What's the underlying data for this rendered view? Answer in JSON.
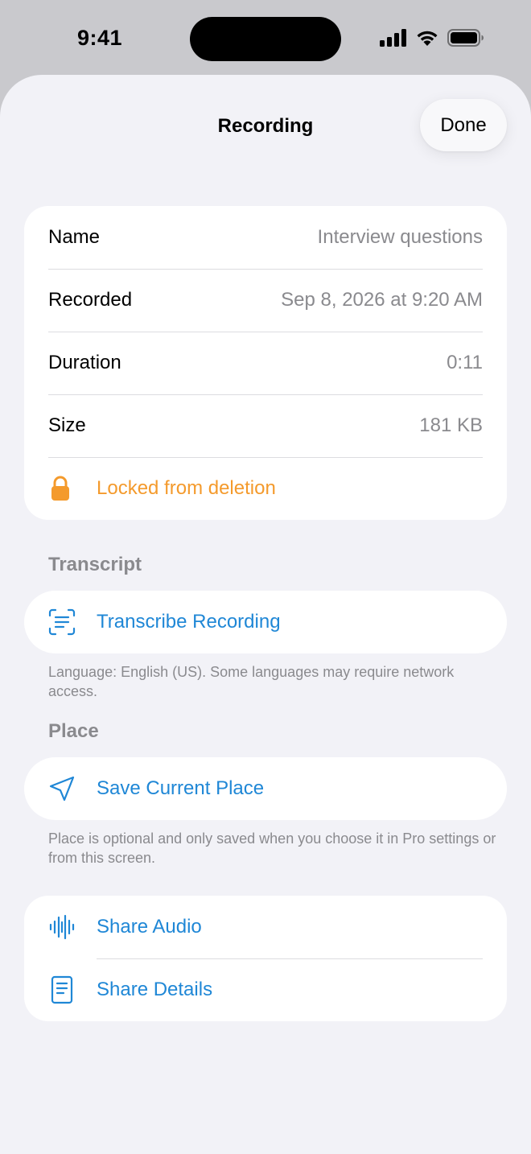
{
  "status_bar": {
    "time": "9:41"
  },
  "sheet": {
    "title": "Recording",
    "done_label": "Done"
  },
  "info": {
    "rows": [
      {
        "label": "Name",
        "value": "Interview questions"
      },
      {
        "label": "Recorded",
        "value": "Sep 8, 2026 at 9:20 AM"
      },
      {
        "label": "Duration",
        "value": "0:11"
      },
      {
        "label": "Size",
        "value": "181 KB"
      }
    ],
    "locked_label": "Locked from deletion"
  },
  "transcript": {
    "header": "Transcript",
    "action_label": "Transcribe Recording",
    "footnote": "Language: English (US). Some languages may require network access."
  },
  "place": {
    "header": "Place",
    "action_label": "Save Current Place",
    "footnote": "Place is optional and only saved when you choose it in Pro settings or from this screen."
  },
  "share": {
    "audio_label": "Share Audio",
    "details_label": "Share Details"
  },
  "colors": {
    "accent": "#1f87d6",
    "lock": "#f49a2c",
    "secondary_text": "#8a8a8e",
    "background": "#f2f2f7"
  }
}
